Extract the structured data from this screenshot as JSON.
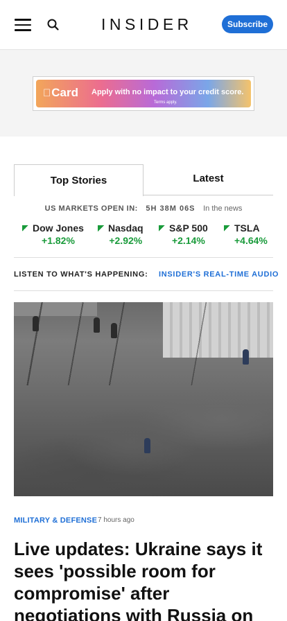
{
  "header": {
    "logo": "INSIDER",
    "subscribe_label": "Subscribe",
    "accent_color": "#1f6fd6"
  },
  "ad": {
    "brand": "Card",
    "tagline": "Apply with no impact to your credit score.",
    "terms": "Terms apply."
  },
  "tabs": [
    {
      "label": "Top Stories",
      "active": true
    },
    {
      "label": "Latest",
      "active": false
    }
  ],
  "markets": {
    "status_label": "US MARKETS OPEN IN:",
    "countdown": "5H 38M 06S",
    "news_label": "In the news",
    "tickers": [
      {
        "name": "Dow Jones",
        "change": "+1.82%"
      },
      {
        "name": "Nasdaq",
        "change": "+2.92%"
      },
      {
        "name": "S&P 500",
        "change": "+2.14%"
      },
      {
        "name": "TSLA",
        "change": "+4.64%"
      }
    ],
    "up_color": "#1a9b3b"
  },
  "listen": {
    "label": "LISTEN TO WHAT'S HAPPENING:",
    "link": "INSIDER'S REAL-TIME AUDIO"
  },
  "story": {
    "category": "MILITARY & DEFENSE",
    "time": "7 hours ago",
    "headline": "Live updates: Ukraine says it sees 'possible room for compromise' after negotiations with Russia on"
  }
}
